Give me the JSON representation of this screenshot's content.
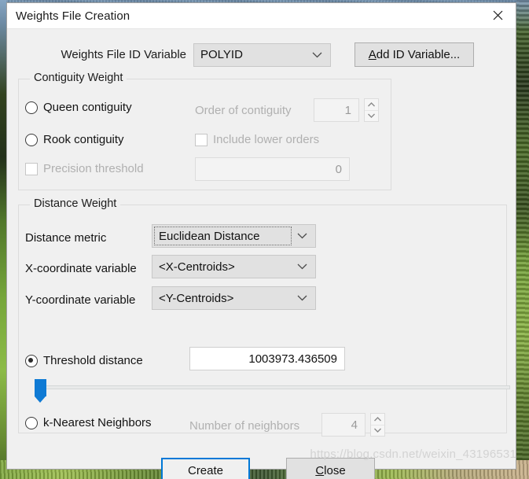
{
  "window": {
    "title": "Weights File Creation",
    "close_icon": "close-icon"
  },
  "id_variable_row": {
    "label": "Weights File ID Variable",
    "combo_value": "POLYID",
    "add_button_accel": "A",
    "add_button_rest": "dd ID Variable..."
  },
  "contiguity": {
    "legend": "Contiguity Weight",
    "queen_label": "Queen contiguity",
    "rook_label": "Rook contiguity",
    "precision_label": "Precision threshold",
    "order_label": "Order of contiguity",
    "order_value": "1",
    "include_lower_label": "Include lower orders",
    "precision_value": "0"
  },
  "distance": {
    "legend": "Distance Weight",
    "metric_label": "Distance metric",
    "metric_value": "Euclidean Distance",
    "x_label": "X-coordinate variable",
    "x_value": "<X-Centroids>",
    "y_label": "Y-coordinate variable",
    "y_value": "<Y-Centroids>",
    "threshold_label": "Threshold distance",
    "threshold_value": "1003973.436509",
    "knn_label": "k-Nearest Neighbors",
    "neighbors_label": "Number of neighbors",
    "neighbors_value": "4"
  },
  "footer": {
    "create_label": "Create",
    "close_accel": "C",
    "close_rest": "lose"
  },
  "watermark": {
    "text": "https://blog.csdn.net/weixin_43196531"
  },
  "colors": {
    "accent": "#0078d7",
    "slider": "#0f7ad4",
    "dialog_bg": "#f0f0f0",
    "titlebar_bg": "#ffffff"
  }
}
